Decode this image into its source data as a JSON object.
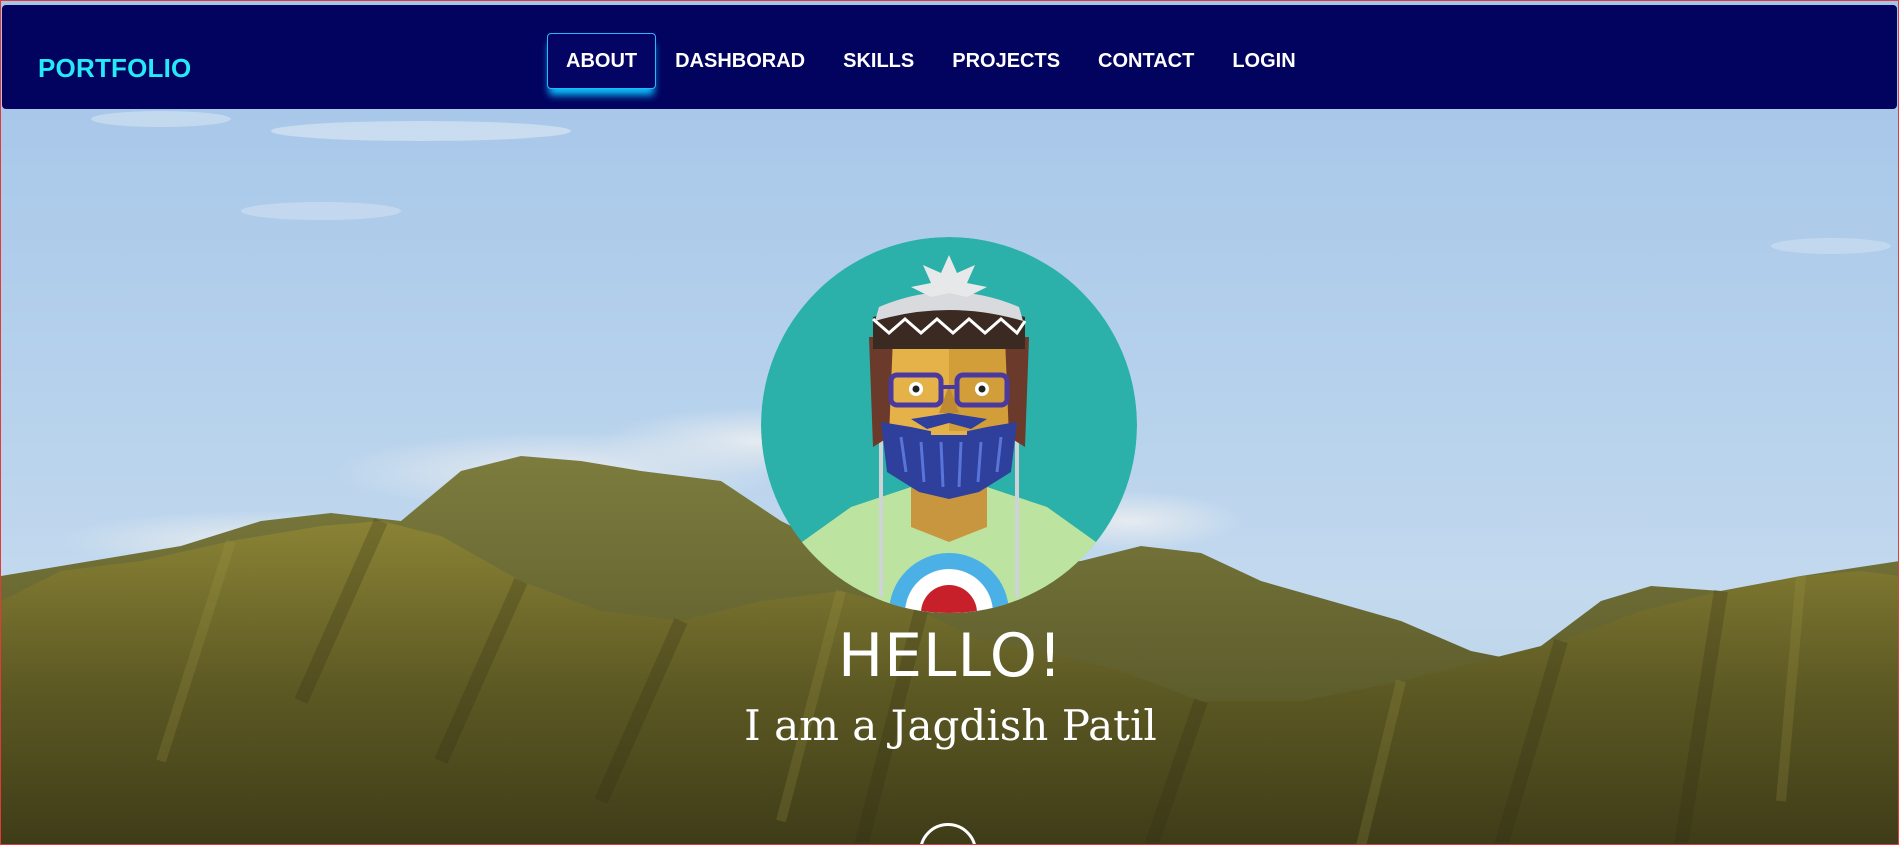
{
  "brand": "PORTFOLIO",
  "nav": {
    "items": [
      {
        "label": "ABOUT",
        "active": true
      },
      {
        "label": "DASHBORAD",
        "active": false
      },
      {
        "label": "SKILLS",
        "active": false
      },
      {
        "label": "PROJECTS",
        "active": false
      },
      {
        "label": "CONTACT",
        "active": false
      },
      {
        "label": "LOGIN",
        "active": false
      }
    ]
  },
  "hero": {
    "greeting": "HELLO!",
    "subtitle": "I am a Jagdish Patil"
  },
  "colors": {
    "navbar": "#02025f",
    "brand": "#25e9f7",
    "nav_active_border": "#26b8ff",
    "avatar_bg": "#2bb1a9",
    "text": "#ffffff"
  },
  "icons": {
    "scroll": "scroll-down-icon"
  }
}
